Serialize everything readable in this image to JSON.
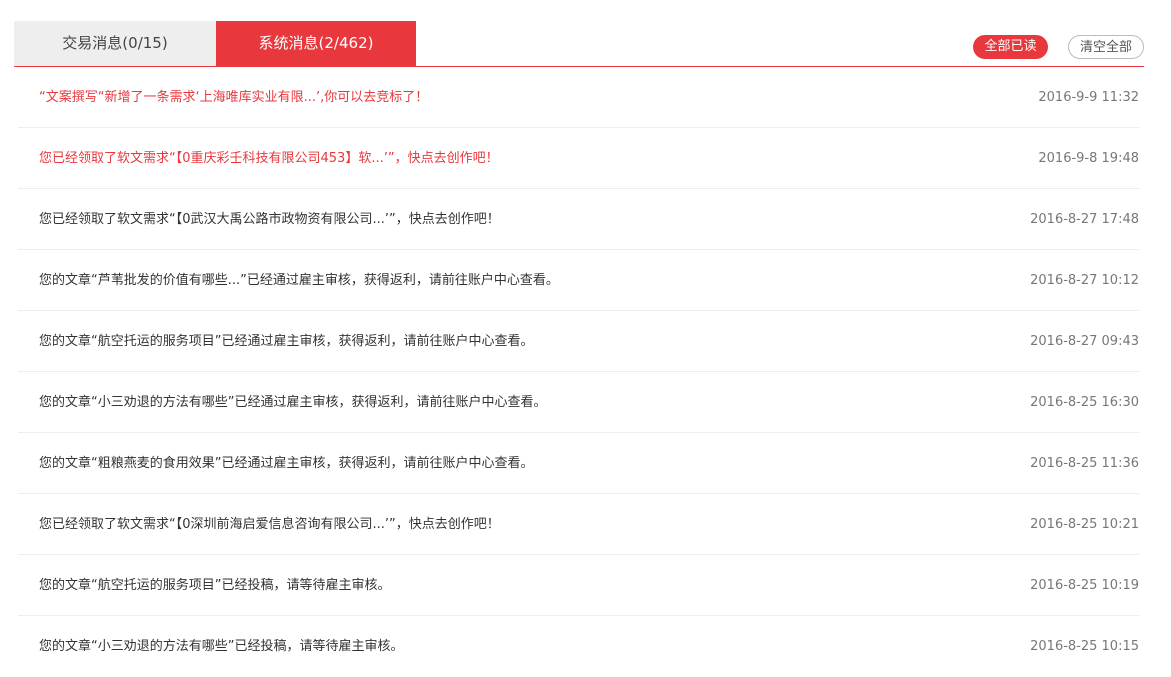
{
  "tabs": {
    "trade": "交易消息(0/15)",
    "system": "系统消息(2/462)"
  },
  "actions": {
    "mark_all_read": "全部已读",
    "clear_all": "清空全部"
  },
  "colors": {
    "accent": "#e8383d",
    "unread_text": "#e8383d",
    "read_text": "#333333",
    "time_text": "#777777"
  },
  "messages": [
    {
      "text": "“文案撰写“新增了一条需求‘上海唯库实业有限...’,你可以去竞标了！",
      "time": "2016-9-9 11:32",
      "unread": true
    },
    {
      "text": "您已经领取了软文需求“【0重庆彩壬科技有限公司453】软...’”，快点去创作吧！",
      "time": "2016-9-8 19:48",
      "unread": true
    },
    {
      "text": "您已经领取了软文需求“【0武汉大禹公路市政物资有限公司...’”，快点去创作吧！",
      "time": "2016-8-27 17:48",
      "unread": false
    },
    {
      "text": "您的文章“芦苇批发的价值有哪些...”已经通过雇主审核，获得返利，请前往账户中心查看。",
      "time": "2016-8-27 10:12",
      "unread": false
    },
    {
      "text": "您的文章“航空托运的服务项目”已经通过雇主审核，获得返利，请前往账户中心查看。",
      "time": "2016-8-27 09:43",
      "unread": false
    },
    {
      "text": "您的文章“小三劝退的方法有哪些”已经通过雇主审核，获得返利，请前往账户中心查看。",
      "time": "2016-8-25 16:30",
      "unread": false
    },
    {
      "text": "您的文章“粗粮燕麦的食用效果”已经通过雇主审核，获得返利，请前往账户中心查看。",
      "time": "2016-8-25 11:36",
      "unread": false
    },
    {
      "text": "您已经领取了软文需求“【0深圳前海启爱信息咨询有限公司...’”，快点去创作吧！",
      "time": "2016-8-25 10:21",
      "unread": false
    },
    {
      "text": "您的文章“航空托运的服务项目”已经投稿，请等待雇主审核。",
      "time": "2016-8-25 10:19",
      "unread": false
    },
    {
      "text": "您的文章“小三劝退的方法有哪些”已经投稿，请等待雇主审核。",
      "time": "2016-8-25 10:15",
      "unread": false
    }
  ]
}
